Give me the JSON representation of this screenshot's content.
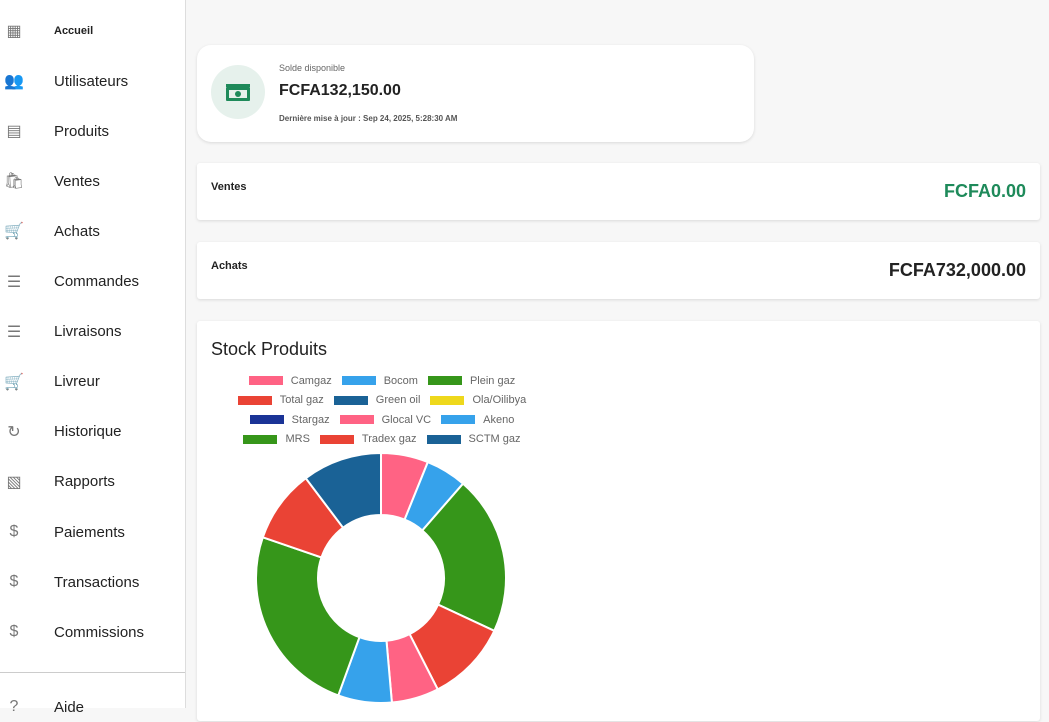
{
  "sidebar": {
    "items": [
      {
        "label": "Accueil",
        "icon": "dashboard-icon",
        "glyph": "▦"
      },
      {
        "label": "Utilisateurs",
        "icon": "people-icon",
        "glyph": "👥"
      },
      {
        "label": "Produits",
        "icon": "archive-icon",
        "glyph": "▤"
      },
      {
        "label": "Ventes",
        "icon": "shopping-bag-icon",
        "glyph": "🛍"
      },
      {
        "label": "Achats",
        "icon": "cart-icon",
        "glyph": "🛒"
      },
      {
        "label": "Commandes",
        "icon": "list-icon",
        "glyph": "☰"
      },
      {
        "label": "Livraisons",
        "icon": "list-icon",
        "glyph": "☰"
      },
      {
        "label": "Livreur",
        "icon": "cart-icon",
        "glyph": "🛒"
      },
      {
        "label": "Historique",
        "icon": "history-icon",
        "glyph": "↻"
      },
      {
        "label": "Rapports",
        "icon": "report-icon",
        "glyph": "▧"
      },
      {
        "label": "Paiements",
        "icon": "dollar-icon",
        "glyph": "$"
      },
      {
        "label": "Transactions",
        "icon": "dollar-icon",
        "glyph": "$"
      },
      {
        "label": "Commissions",
        "icon": "dollar-icon",
        "glyph": "$"
      }
    ],
    "footer": {
      "label": "Aide",
      "icon": "help-icon"
    }
  },
  "balance": {
    "label": "Solde disponible",
    "amount": "FCFA132,150.00",
    "updated": "Dernière mise à jour : Sep 24, 2025, 5:28:30 AM",
    "icon": "money-icon"
  },
  "sales": {
    "label": "Ventes",
    "amount": "FCFA0.00",
    "color": "#1e8a5a"
  },
  "purchases": {
    "label": "Achats",
    "amount": "FCFA732,000.00"
  },
  "chart_data": {
    "type": "pie",
    "title": "Stock Produits",
    "donut": true,
    "categories": [
      "Camgaz",
      "Bocom",
      "Plein gaz",
      "Total gaz",
      "Green oil",
      "Ola/Oilibya",
      "Stargaz",
      "Glocal VC",
      "Akeno",
      "MRS",
      "Tradex gaz",
      "SCTM gaz"
    ],
    "values": [
      22,
      19,
      74,
      38,
      0,
      0,
      0,
      22,
      25,
      89,
      34,
      37
    ],
    "colors": [
      "#ff6384",
      "#36a2eb",
      "#36961a",
      "#ea4335",
      "#1a6296",
      "#eed81c",
      "#1a3396",
      "#ff6384",
      "#36a2eb",
      "#36961a",
      "#ea4335",
      "#1a6296"
    ],
    "legend": "top"
  }
}
